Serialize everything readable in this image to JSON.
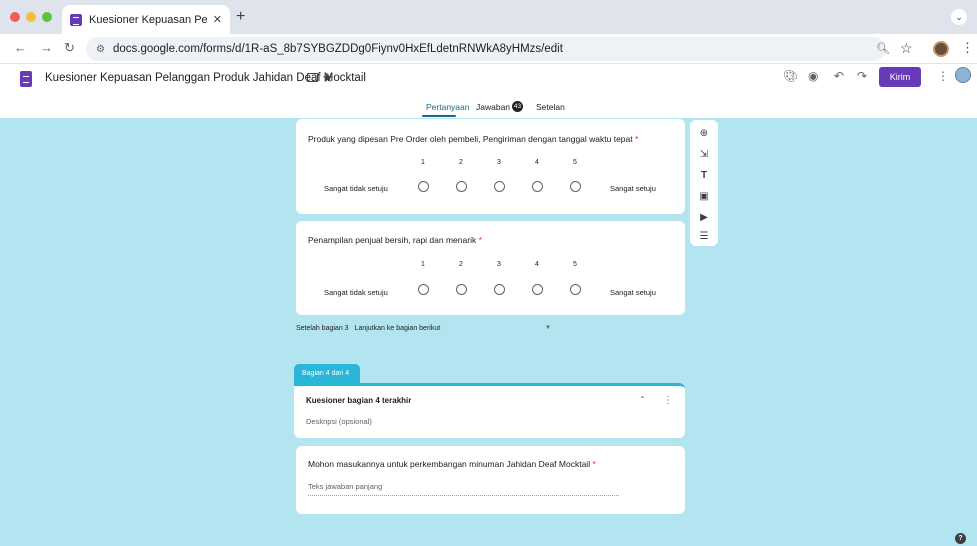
{
  "browser": {
    "tab_title": "Kuesioner Kepuasan Pelangg",
    "tab_close": "✕",
    "new_tab": "+",
    "url": "docs.google.com/forms/d/1R-aS_8b7SYBGZDDg0Fiynv0HxEfLdetnRNWkA8yHMzs/edit"
  },
  "header": {
    "doc_title": "Kuesioner Kepuasan Pelanggan Produk Jahidan Deaf Mocktail",
    "send_label": "Kirim"
  },
  "tabs": {
    "questions": "Pertanyaan",
    "responses": "Jawaban",
    "response_count": "43",
    "settings": "Setelan"
  },
  "questions": [
    {
      "title": "Produk yang dipesan Pre Order oleh pembeli, Pengiriman dengan tanggal waktu tepat",
      "required_mark": "*",
      "scale": [
        "1",
        "2",
        "3",
        "4",
        "5"
      ],
      "low_label": "Sangat tidak setuju",
      "high_label": "Sangat setuju"
    },
    {
      "title": "Penampilan penjual bersih, rapi dan menarik",
      "required_mark": "*",
      "scale": [
        "1",
        "2",
        "3",
        "4",
        "5"
      ],
      "low_label": "Sangat tidak setuju",
      "high_label": "Sangat setuju"
    }
  ],
  "after_section": {
    "label": "Setelah bagian 3",
    "value": "Lanjutkan ke bagian berikut"
  },
  "section": {
    "chip": "Bagian 4 dari 4",
    "title": "Kuesioner bagian 4 terakhir",
    "description": "Deskripsi (opsional)"
  },
  "last_question": {
    "title": "Mohon masukannya untuk perkembangan minuman Jahidan Deaf Mocktail",
    "required_mark": "*",
    "placeholder": "Teks jawaban panjang"
  },
  "colors": {
    "background": "#b3e5f0",
    "accent": "#673ab7",
    "section_chip": "#29b6d8",
    "active_tab": "#1a6b7a",
    "required": "#d93025"
  },
  "icons": {
    "toolbar": [
      "add-question-icon",
      "import-questions-icon",
      "add-title-icon",
      "add-image-icon",
      "add-video-icon",
      "add-section-icon"
    ]
  }
}
